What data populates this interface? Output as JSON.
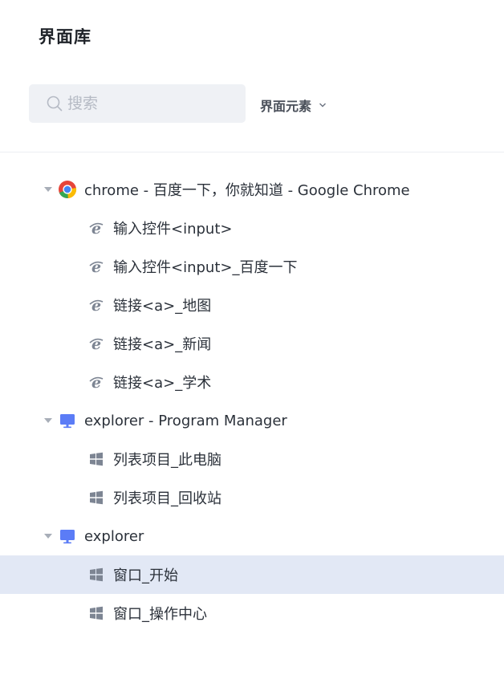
{
  "header": {
    "title": "界面库"
  },
  "search": {
    "placeholder": "搜索"
  },
  "filter": {
    "label": "界面元素"
  },
  "tree": {
    "chrome": {
      "label": "chrome - 百度一下，你就知道 - Google Chrome",
      "icon": "chrome-icon",
      "children": [
        {
          "label": "输入控件<input>",
          "icon": "ie-icon"
        },
        {
          "label": "输入控件<input>_百度一下",
          "icon": "ie-icon"
        },
        {
          "label": "链接<a>_地图",
          "icon": "ie-icon"
        },
        {
          "label": "链接<a>_新闻",
          "icon": "ie-icon"
        },
        {
          "label": "链接<a>_学术",
          "icon": "ie-icon"
        }
      ]
    },
    "explorer_pm": {
      "label": "explorer - Program Manager",
      "icon": "monitor-icon",
      "children": [
        {
          "label": "列表项目_此电脑",
          "icon": "windows-icon"
        },
        {
          "label": "列表项目_回收站",
          "icon": "windows-icon"
        }
      ]
    },
    "explorer": {
      "label": "explorer",
      "icon": "monitor-icon",
      "children": [
        {
          "label": "窗口_开始",
          "icon": "windows-icon",
          "selected": true
        },
        {
          "label": "窗口_操作中心",
          "icon": "windows-icon"
        }
      ]
    }
  },
  "colors": {
    "selected_row": "#e2e8f5",
    "search_bg": "#eff1f5",
    "monitor_blue": "#5b7cf6",
    "icon_gray": "#7d8593"
  }
}
